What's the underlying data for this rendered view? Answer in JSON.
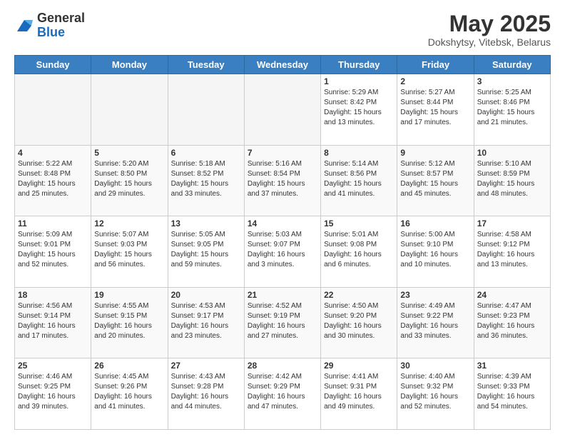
{
  "logo": {
    "general": "General",
    "blue": "Blue"
  },
  "title": {
    "month_year": "May 2025",
    "location": "Dokshytsy, Vitebsk, Belarus"
  },
  "days_of_week": [
    "Sunday",
    "Monday",
    "Tuesday",
    "Wednesday",
    "Thursday",
    "Friday",
    "Saturday"
  ],
  "weeks": [
    [
      {
        "num": "",
        "info": "",
        "empty": true
      },
      {
        "num": "",
        "info": "",
        "empty": true
      },
      {
        "num": "",
        "info": "",
        "empty": true
      },
      {
        "num": "",
        "info": "",
        "empty": true
      },
      {
        "num": "1",
        "info": "Sunrise: 5:29 AM\nSunset: 8:42 PM\nDaylight: 15 hours\nand 13 minutes.",
        "empty": false
      },
      {
        "num": "2",
        "info": "Sunrise: 5:27 AM\nSunset: 8:44 PM\nDaylight: 15 hours\nand 17 minutes.",
        "empty": false
      },
      {
        "num": "3",
        "info": "Sunrise: 5:25 AM\nSunset: 8:46 PM\nDaylight: 15 hours\nand 21 minutes.",
        "empty": false
      }
    ],
    [
      {
        "num": "4",
        "info": "Sunrise: 5:22 AM\nSunset: 8:48 PM\nDaylight: 15 hours\nand 25 minutes.",
        "empty": false
      },
      {
        "num": "5",
        "info": "Sunrise: 5:20 AM\nSunset: 8:50 PM\nDaylight: 15 hours\nand 29 minutes.",
        "empty": false
      },
      {
        "num": "6",
        "info": "Sunrise: 5:18 AM\nSunset: 8:52 PM\nDaylight: 15 hours\nand 33 minutes.",
        "empty": false
      },
      {
        "num": "7",
        "info": "Sunrise: 5:16 AM\nSunset: 8:54 PM\nDaylight: 15 hours\nand 37 minutes.",
        "empty": false
      },
      {
        "num": "8",
        "info": "Sunrise: 5:14 AM\nSunset: 8:56 PM\nDaylight: 15 hours\nand 41 minutes.",
        "empty": false
      },
      {
        "num": "9",
        "info": "Sunrise: 5:12 AM\nSunset: 8:57 PM\nDaylight: 15 hours\nand 45 minutes.",
        "empty": false
      },
      {
        "num": "10",
        "info": "Sunrise: 5:10 AM\nSunset: 8:59 PM\nDaylight: 15 hours\nand 48 minutes.",
        "empty": false
      }
    ],
    [
      {
        "num": "11",
        "info": "Sunrise: 5:09 AM\nSunset: 9:01 PM\nDaylight: 15 hours\nand 52 minutes.",
        "empty": false
      },
      {
        "num": "12",
        "info": "Sunrise: 5:07 AM\nSunset: 9:03 PM\nDaylight: 15 hours\nand 56 minutes.",
        "empty": false
      },
      {
        "num": "13",
        "info": "Sunrise: 5:05 AM\nSunset: 9:05 PM\nDaylight: 15 hours\nand 59 minutes.",
        "empty": false
      },
      {
        "num": "14",
        "info": "Sunrise: 5:03 AM\nSunset: 9:07 PM\nDaylight: 16 hours\nand 3 minutes.",
        "empty": false
      },
      {
        "num": "15",
        "info": "Sunrise: 5:01 AM\nSunset: 9:08 PM\nDaylight: 16 hours\nand 6 minutes.",
        "empty": false
      },
      {
        "num": "16",
        "info": "Sunrise: 5:00 AM\nSunset: 9:10 PM\nDaylight: 16 hours\nand 10 minutes.",
        "empty": false
      },
      {
        "num": "17",
        "info": "Sunrise: 4:58 AM\nSunset: 9:12 PM\nDaylight: 16 hours\nand 13 minutes.",
        "empty": false
      }
    ],
    [
      {
        "num": "18",
        "info": "Sunrise: 4:56 AM\nSunset: 9:14 PM\nDaylight: 16 hours\nand 17 minutes.",
        "empty": false
      },
      {
        "num": "19",
        "info": "Sunrise: 4:55 AM\nSunset: 9:15 PM\nDaylight: 16 hours\nand 20 minutes.",
        "empty": false
      },
      {
        "num": "20",
        "info": "Sunrise: 4:53 AM\nSunset: 9:17 PM\nDaylight: 16 hours\nand 23 minutes.",
        "empty": false
      },
      {
        "num": "21",
        "info": "Sunrise: 4:52 AM\nSunset: 9:19 PM\nDaylight: 16 hours\nand 27 minutes.",
        "empty": false
      },
      {
        "num": "22",
        "info": "Sunrise: 4:50 AM\nSunset: 9:20 PM\nDaylight: 16 hours\nand 30 minutes.",
        "empty": false
      },
      {
        "num": "23",
        "info": "Sunrise: 4:49 AM\nSunset: 9:22 PM\nDaylight: 16 hours\nand 33 minutes.",
        "empty": false
      },
      {
        "num": "24",
        "info": "Sunrise: 4:47 AM\nSunset: 9:23 PM\nDaylight: 16 hours\nand 36 minutes.",
        "empty": false
      }
    ],
    [
      {
        "num": "25",
        "info": "Sunrise: 4:46 AM\nSunset: 9:25 PM\nDaylight: 16 hours\nand 39 minutes.",
        "empty": false
      },
      {
        "num": "26",
        "info": "Sunrise: 4:45 AM\nSunset: 9:26 PM\nDaylight: 16 hours\nand 41 minutes.",
        "empty": false
      },
      {
        "num": "27",
        "info": "Sunrise: 4:43 AM\nSunset: 9:28 PM\nDaylight: 16 hours\nand 44 minutes.",
        "empty": false
      },
      {
        "num": "28",
        "info": "Sunrise: 4:42 AM\nSunset: 9:29 PM\nDaylight: 16 hours\nand 47 minutes.",
        "empty": false
      },
      {
        "num": "29",
        "info": "Sunrise: 4:41 AM\nSunset: 9:31 PM\nDaylight: 16 hours\nand 49 minutes.",
        "empty": false
      },
      {
        "num": "30",
        "info": "Sunrise: 4:40 AM\nSunset: 9:32 PM\nDaylight: 16 hours\nand 52 minutes.",
        "empty": false
      },
      {
        "num": "31",
        "info": "Sunrise: 4:39 AM\nSunset: 9:33 PM\nDaylight: 16 hours\nand 54 minutes.",
        "empty": false
      }
    ]
  ],
  "colors": {
    "header_bg": "#3a7fc1",
    "header_text": "#ffffff",
    "border": "#cccccc"
  }
}
